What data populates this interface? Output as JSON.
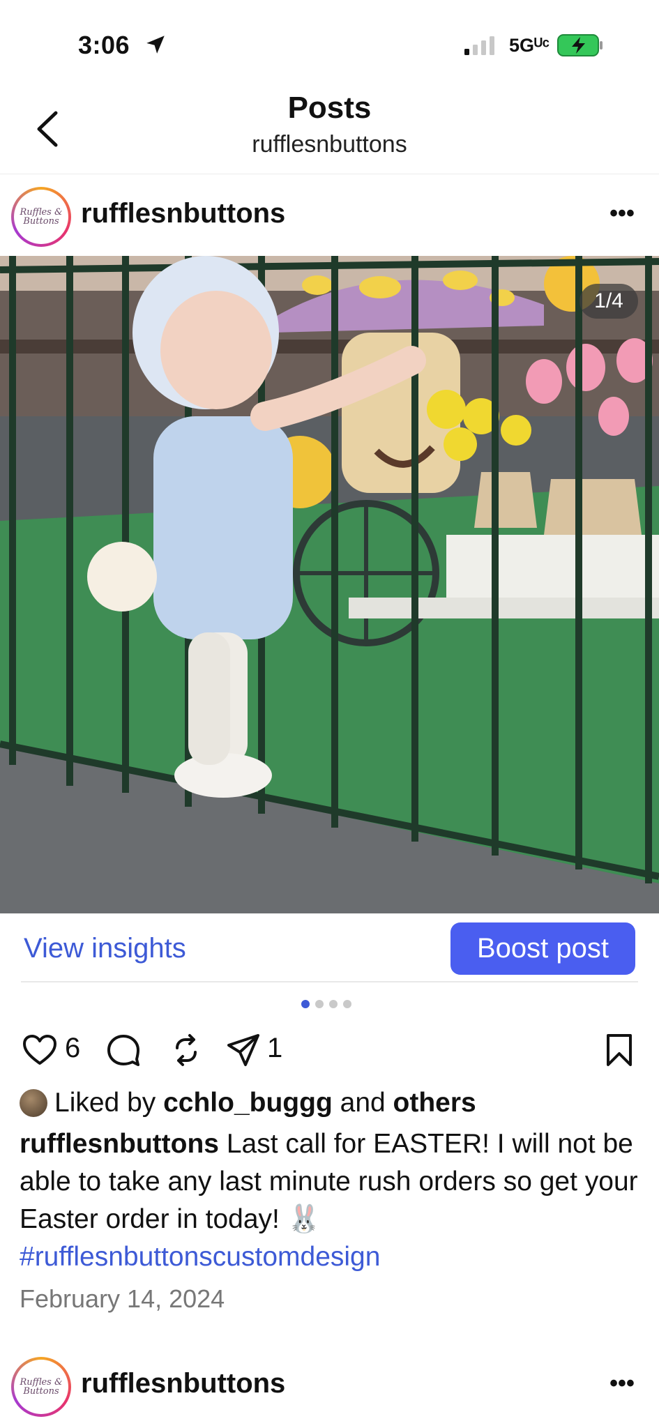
{
  "status_bar": {
    "time": "3:06",
    "network": "5Gᵁᶜ",
    "icons": [
      "location-arrow-icon",
      "signal-bars-icon",
      "battery-charging-icon"
    ]
  },
  "header": {
    "title": "Posts",
    "subtitle": "rufflesnbuttons"
  },
  "post": {
    "username": "rufflesnbuttons",
    "avatar_text": "Ruffles & Buttons",
    "page_counter": "1/4",
    "view_insights_label": "View insights",
    "boost_label": "Boost post",
    "carousel": {
      "total": 4,
      "active_index": 0
    },
    "likes_count": "6",
    "shares_count": "1",
    "liked_by_prefix": "Liked by",
    "liked_by_user": "cchlo_buggg",
    "liked_by_and": "and",
    "liked_by_others": "others",
    "caption_user": "rufflesnbuttons",
    "caption_text": "Last call for EASTER! I will not be able to take any last minute rush orders so get your Easter order in today! 🐰",
    "hashtag": "#rufflesnbuttonscustomdesign",
    "date": "February 14, 2024"
  },
  "next_post": {
    "username": "rufflesnbuttons",
    "avatar_text": "Ruffles & Buttons"
  },
  "colors": {
    "accent": "#3d5ad6",
    "boost": "#4a5ef0",
    "date": "#777777"
  }
}
